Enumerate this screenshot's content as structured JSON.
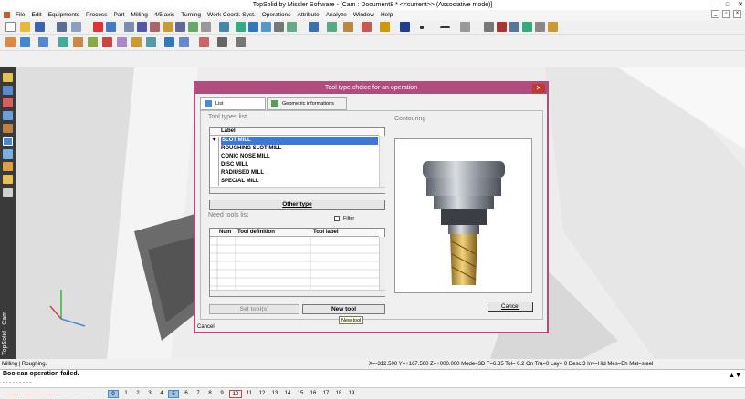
{
  "window": {
    "title": "TopSolid by Missler Software - [Cam : Document8 * <<current>> (Associative mode)]",
    "controls": [
      "–",
      "□",
      "✕"
    ]
  },
  "menu": [
    "File",
    "Edit",
    "Equipments",
    "Process",
    "Part",
    "Milling",
    "4/5 axis",
    "Turning",
    "Work Coord. Syst.",
    "Operations",
    "Attribute",
    "Analyze",
    "Window",
    "Help"
  ],
  "brand": "TopSolid · Cam",
  "dialog": {
    "title": "Tool type choice for an operation",
    "close": "✕",
    "tabs": [
      "List",
      "Geometric informations"
    ],
    "tool_types_label": "Tool types list",
    "operation_label": "Contouring",
    "column_label": "Label",
    "tool_types": [
      "SLOT MILL",
      "ROUGHING SLOT MILL",
      "CONIC NOSE MILL",
      "DISC MILL",
      "RADIUSED MILL",
      "SPECIAL MILL"
    ],
    "selected_marker": "✦",
    "other_type": "Other type",
    "need_tools_label": "Need tools list",
    "filter": "Filter",
    "tools_columns": [
      "Num",
      "Tool definition",
      "Tool label"
    ],
    "set_tools": "Set tool(s)",
    "new_tool": "New tool",
    "cancel": "Cancel",
    "status": "Cancel",
    "tooltip": "New tool"
  },
  "status": {
    "left": "Milling | Roughing.",
    "coords": "X=-312.500   Y=+167.500  Z=+000.000  Mode=3D  T=6.35   Tol= 0.2   On  Tra=0   Lay= 0   Desc 3   Inv=Hid  Mes=Eh  Mat=steel"
  },
  "message": {
    "text": "Boolean operation failed.",
    "sub": "- - - - - - - - -"
  },
  "layers": [
    "0",
    "1",
    "2",
    "3",
    "4",
    "5",
    "6",
    "7",
    "8",
    "9",
    "10",
    "11",
    "12",
    "13",
    "14",
    "15",
    "16",
    "17",
    "18",
    "19"
  ],
  "colors": {
    "accent": "#b04c7e",
    "selection": "#3d78d8"
  }
}
